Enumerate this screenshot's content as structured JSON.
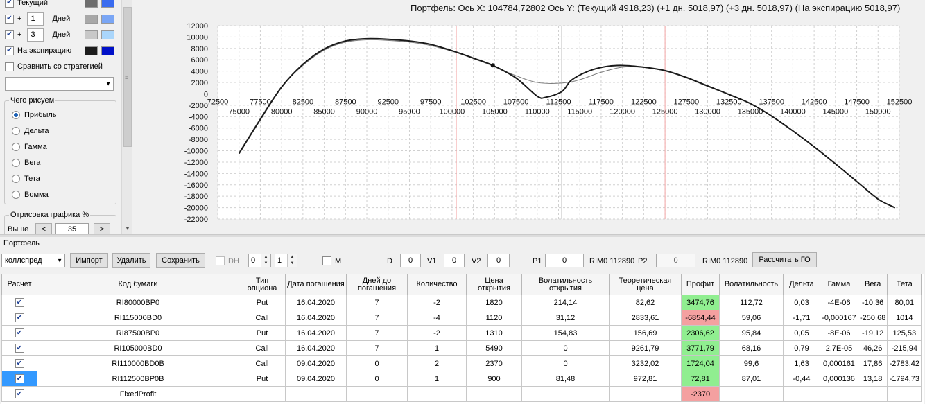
{
  "left_panel": {
    "rows": [
      {
        "checked": true,
        "prefix": "",
        "value": "",
        "unit": "",
        "label": "Текущий",
        "color1": "#6e6e6e",
        "color2": "#3a6cf0"
      },
      {
        "checked": true,
        "prefix": "+",
        "value": "1",
        "unit": "Дней",
        "label": "",
        "color1": "#a8a8a8",
        "color2": "#7aa6f5"
      },
      {
        "checked": true,
        "prefix": "+",
        "value": "3",
        "unit": "Дней",
        "label": "",
        "color1": "#c8c8c8",
        "color2": "#aad6fb"
      },
      {
        "checked": true,
        "prefix": "",
        "value": "",
        "unit": "",
        "label": "На экспирацию",
        "color1": "#1c1c1c",
        "color2": "#0010c8"
      }
    ],
    "compare_label": "Сравнить со стратегией",
    "strategy_select_value": "",
    "plot_group": {
      "title": "Чего рисуем",
      "selected": "Прибыль",
      "options": [
        "Прибыль",
        "Дельта",
        "Гамма",
        "Вега",
        "Тета",
        "Вомма"
      ]
    },
    "draw_group": {
      "title": "Отрисовка графика %",
      "higher_label": "Выше",
      "prev_label": "<",
      "value": "35",
      "next_label": ">"
    }
  },
  "chart": {
    "title": "Портфель: Ось X: 104784,72802 Ось Y:  (Текущий 4918,23)  (+1 дн. 5018,97)  (+3 дн. 5018,97)  (На экспирацию 5018,97)"
  },
  "chart_data": {
    "type": "line",
    "title": "",
    "xlabel": "",
    "ylabel": "",
    "xlim": [
      72500,
      152500
    ],
    "ylim": [
      -22000,
      12000
    ],
    "grid": true,
    "x_ticks_upper": [
      72500,
      77500,
      82500,
      87500,
      92500,
      97500,
      102500,
      107500,
      112500,
      117500,
      122500,
      127500,
      132500,
      137500,
      142500,
      147500,
      152500
    ],
    "x_ticks_lower": [
      75000,
      80000,
      85000,
      90000,
      95000,
      100000,
      105000,
      110000,
      115000,
      120000,
      125000,
      130000,
      135000,
      140000,
      145000,
      150000
    ],
    "y_ticks": [
      12000,
      10000,
      8000,
      6000,
      4000,
      2000,
      0,
      -2000,
      -4000,
      -6000,
      -8000,
      -10000,
      -12000,
      -14000,
      -16000,
      -18000,
      -20000,
      -22000
    ],
    "vertical_markers": [
      {
        "x": 100500,
        "color": "#f4a6a6"
      },
      {
        "x": 112890,
        "color": "#606060"
      },
      {
        "x": 125000,
        "color": "#f4a6a6"
      }
    ],
    "marker_point": {
      "x": 104785,
      "y": 5019
    },
    "series": [
      {
        "color": "#1a1a1a",
        "width": 2,
        "x": [
          75000,
          77500,
          80000,
          82500,
          85000,
          87500,
          90000,
          92500,
          95000,
          97500,
          100000,
          102500,
          104785,
          107500,
          110000,
          111000,
          112890,
          114000,
          116000,
          118000,
          120000,
          122500,
          125000,
          127500,
          130000,
          132500,
          135000,
          137500,
          140000,
          142500,
          145000,
          147500,
          150000,
          152000
        ],
        "y": [
          -10500,
          -4500,
          1200,
          5200,
          7900,
          9300,
          9700,
          9600,
          9300,
          8700,
          7600,
          6300,
          5019,
          2800,
          -400,
          -600,
          400,
          2400,
          4000,
          4800,
          5000,
          4700,
          4100,
          2900,
          1400,
          -100,
          -1700,
          -3900,
          -6500,
          -9300,
          -12300,
          -15400,
          -18500,
          -20000
        ]
      },
      {
        "color": "#7a7a7a",
        "width": 1,
        "x": [
          75000,
          77500,
          80000,
          82500,
          85000,
          87500,
          90000,
          92500,
          95000,
          97500,
          100000,
          102500,
          104785,
          107500,
          110000,
          112890,
          115000,
          117500,
          120000,
          122500,
          125000,
          127500,
          130000,
          132500
        ],
        "y": [
          -10300,
          -4300,
          1300,
          5000,
          7700,
          9100,
          9500,
          9400,
          9100,
          8500,
          7500,
          6200,
          4918,
          3200,
          2000,
          1900,
          2500,
          3800,
          4700,
          4650,
          4000,
          2800,
          1300,
          -100
        ]
      }
    ]
  },
  "bottom": {
    "section_title": "Портфель",
    "strategy_select": "коллспред",
    "import_label": "Импорт",
    "delete_label": "Удалить",
    "save_label": "Сохранить",
    "dh_label": "DH",
    "spin1_value": "0",
    "spin2_value": "1",
    "m_label": "M",
    "d_label": "D",
    "d_value": "0",
    "v1_label": "V1",
    "v1_value": "0",
    "v2_label": "V2",
    "v2_value": "0",
    "p1_label": "P1",
    "p1_value": "0",
    "rim1_label": "RIM0 112890",
    "p2_label": "P2",
    "p2_value": "0",
    "rim2_label": "RIM0 112890",
    "calc_label": "Рассчитать ГО"
  },
  "grid": {
    "headers": [
      "Расчет",
      "Код бумаги",
      "Тип опциона",
      "Дата погашения",
      "Дней до погашения",
      "Количество",
      "Цена открытия",
      "Волатильность открытия",
      "Теоретическая цена",
      "Профит",
      "Волатильность",
      "Дельта",
      "Гамма",
      "Вега",
      "Тета"
    ],
    "rows": [
      {
        "checked": true,
        "selected": false,
        "profit_color": "green",
        "cells": [
          "RI80000BP0",
          "Put",
          "16.04.2020",
          "7",
          "-2",
          "1820",
          "214,14",
          "82,62",
          "3474,76",
          "112,72",
          "0,03",
          "-4E-06",
          "-10,36",
          "80,01"
        ]
      },
      {
        "checked": true,
        "selected": false,
        "profit_color": "red",
        "cells": [
          "RI115000BD0",
          "Call",
          "16.04.2020",
          "7",
          "-4",
          "1120",
          "31,12",
          "2833,61",
          "-6854,44",
          "59,06",
          "-1,71",
          "-0,000167",
          "-250,68",
          "1014"
        ]
      },
      {
        "checked": true,
        "selected": false,
        "profit_color": "green",
        "cells": [
          "RI87500BP0",
          "Put",
          "16.04.2020",
          "7",
          "-2",
          "1310",
          "154,83",
          "156,69",
          "2306,62",
          "95,84",
          "0,05",
          "-8E-06",
          "-19,12",
          "125,53"
        ]
      },
      {
        "checked": true,
        "selected": false,
        "profit_color": "green",
        "cells": [
          "RI105000BD0",
          "Call",
          "16.04.2020",
          "7",
          "1",
          "5490",
          "0",
          "9261,79",
          "3771,79",
          "68,16",
          "0,79",
          "2,7E-05",
          "46,26",
          "-215,94"
        ]
      },
      {
        "checked": true,
        "selected": false,
        "profit_color": "green",
        "cells": [
          "RI110000BD0B",
          "Call",
          "09.04.2020",
          "0",
          "2",
          "2370",
          "0",
          "3232,02",
          "1724,04",
          "99,6",
          "1,63",
          "0,000161",
          "17,86",
          "-2783,42"
        ]
      },
      {
        "checked": true,
        "selected": true,
        "profit_color": "green",
        "cells": [
          "RI112500BP0B",
          "Put",
          "09.04.2020",
          "0",
          "1",
          "900",
          "81,48",
          "972,81",
          "72,81",
          "87,01",
          "-0,44",
          "0,000136",
          "13,18",
          "-1794,73"
        ]
      },
      {
        "checked": true,
        "selected": false,
        "profit_color": "red",
        "cells": [
          "FixedProfit",
          "",
          "",
          "",
          "",
          "",
          "",
          "",
          "-2370",
          "",
          "",
          "",
          "",
          ""
        ]
      }
    ]
  }
}
